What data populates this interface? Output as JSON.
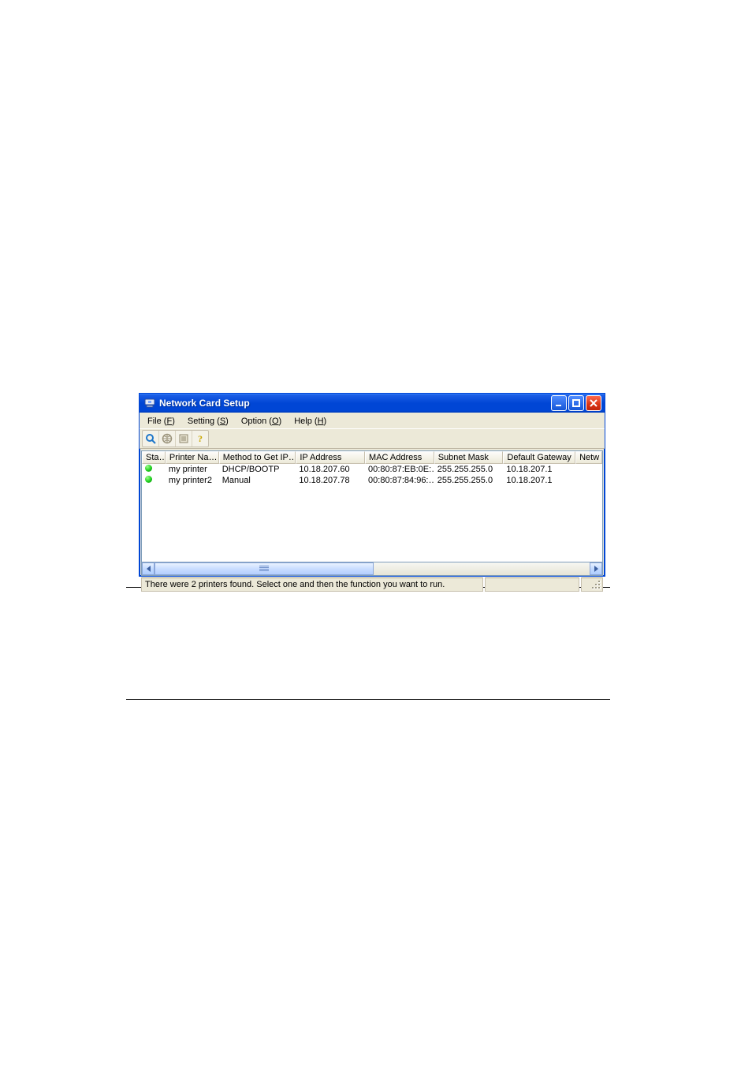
{
  "window": {
    "title": "Network Card Setup"
  },
  "menu": {
    "file": {
      "label": "File",
      "accel": "F"
    },
    "setting": {
      "label": "Setting",
      "accel": "S"
    },
    "option": {
      "label": "Option",
      "accel": "O"
    },
    "help": {
      "label": "Help",
      "accel": "H"
    }
  },
  "columns": {
    "c0": "Sta…",
    "c1": "Printer Na…",
    "c2": "Method to Get IP…",
    "c3": "IP Address",
    "c4": "MAC Address",
    "c5": "Subnet Mask",
    "c6": "Default Gateway",
    "c7": "Netw"
  },
  "rows": [
    {
      "printer": "my printer",
      "method": "DHCP/BOOTP",
      "ip": "10.18.207.60",
      "mac": "00:80:87:EB:0E:…",
      "mask": "255.255.255.0",
      "gw": "10.18.207.1"
    },
    {
      "printer": "my printer2",
      "method": "Manual",
      "ip": "10.18.207.78",
      "mac": "00:80:87:84:96:…",
      "mask": "255.255.255.0",
      "gw": "10.18.207.1"
    }
  ],
  "statusbar": {
    "text": "There were 2 printers found. Select one and then the function you want to run."
  }
}
